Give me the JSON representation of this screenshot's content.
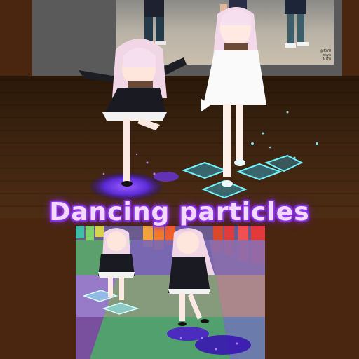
{
  "caption": {
    "text": "Dancing particles"
  },
  "reference_video": {
    "watermark": "@MOYU\nmoyu\nAUTO"
  },
  "colors": {
    "accent_purple": "#8a2be2",
    "caption_fill": "#f2d9ff",
    "cyan_pad": "#6ff4ff",
    "violet_pad": "#5b2bd6"
  }
}
